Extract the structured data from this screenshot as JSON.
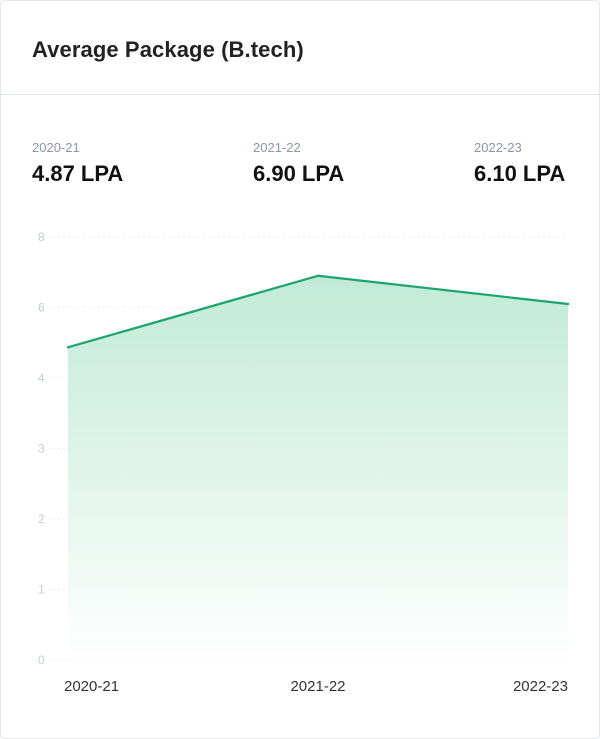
{
  "card": {
    "title": "Average Package (B.tech)"
  },
  "stats": [
    {
      "year": "2020-21",
      "value": "4.87 LPA"
    },
    {
      "year": "2021-22",
      "value": "6.90 LPA"
    },
    {
      "year": "2022-23",
      "value": "6.10 LPA"
    }
  ],
  "colors": {
    "line": "#1aa56f",
    "fill": "#bfe9d6",
    "grid": "#e8ecef"
  },
  "chart_data": {
    "type": "area",
    "title": "Average Package (B.tech)",
    "categories": [
      "2020-21",
      "2021-22",
      "2022-23"
    ],
    "series": [
      {
        "values": [
          4.87,
          6.9,
          6.1
        ]
      }
    ],
    "y_ticks": [
      "0",
      "1",
      "2",
      "3",
      "4",
      "6",
      "8"
    ],
    "ylim": [
      0,
      8
    ],
    "grid": true,
    "xlabel": "",
    "ylabel": ""
  }
}
